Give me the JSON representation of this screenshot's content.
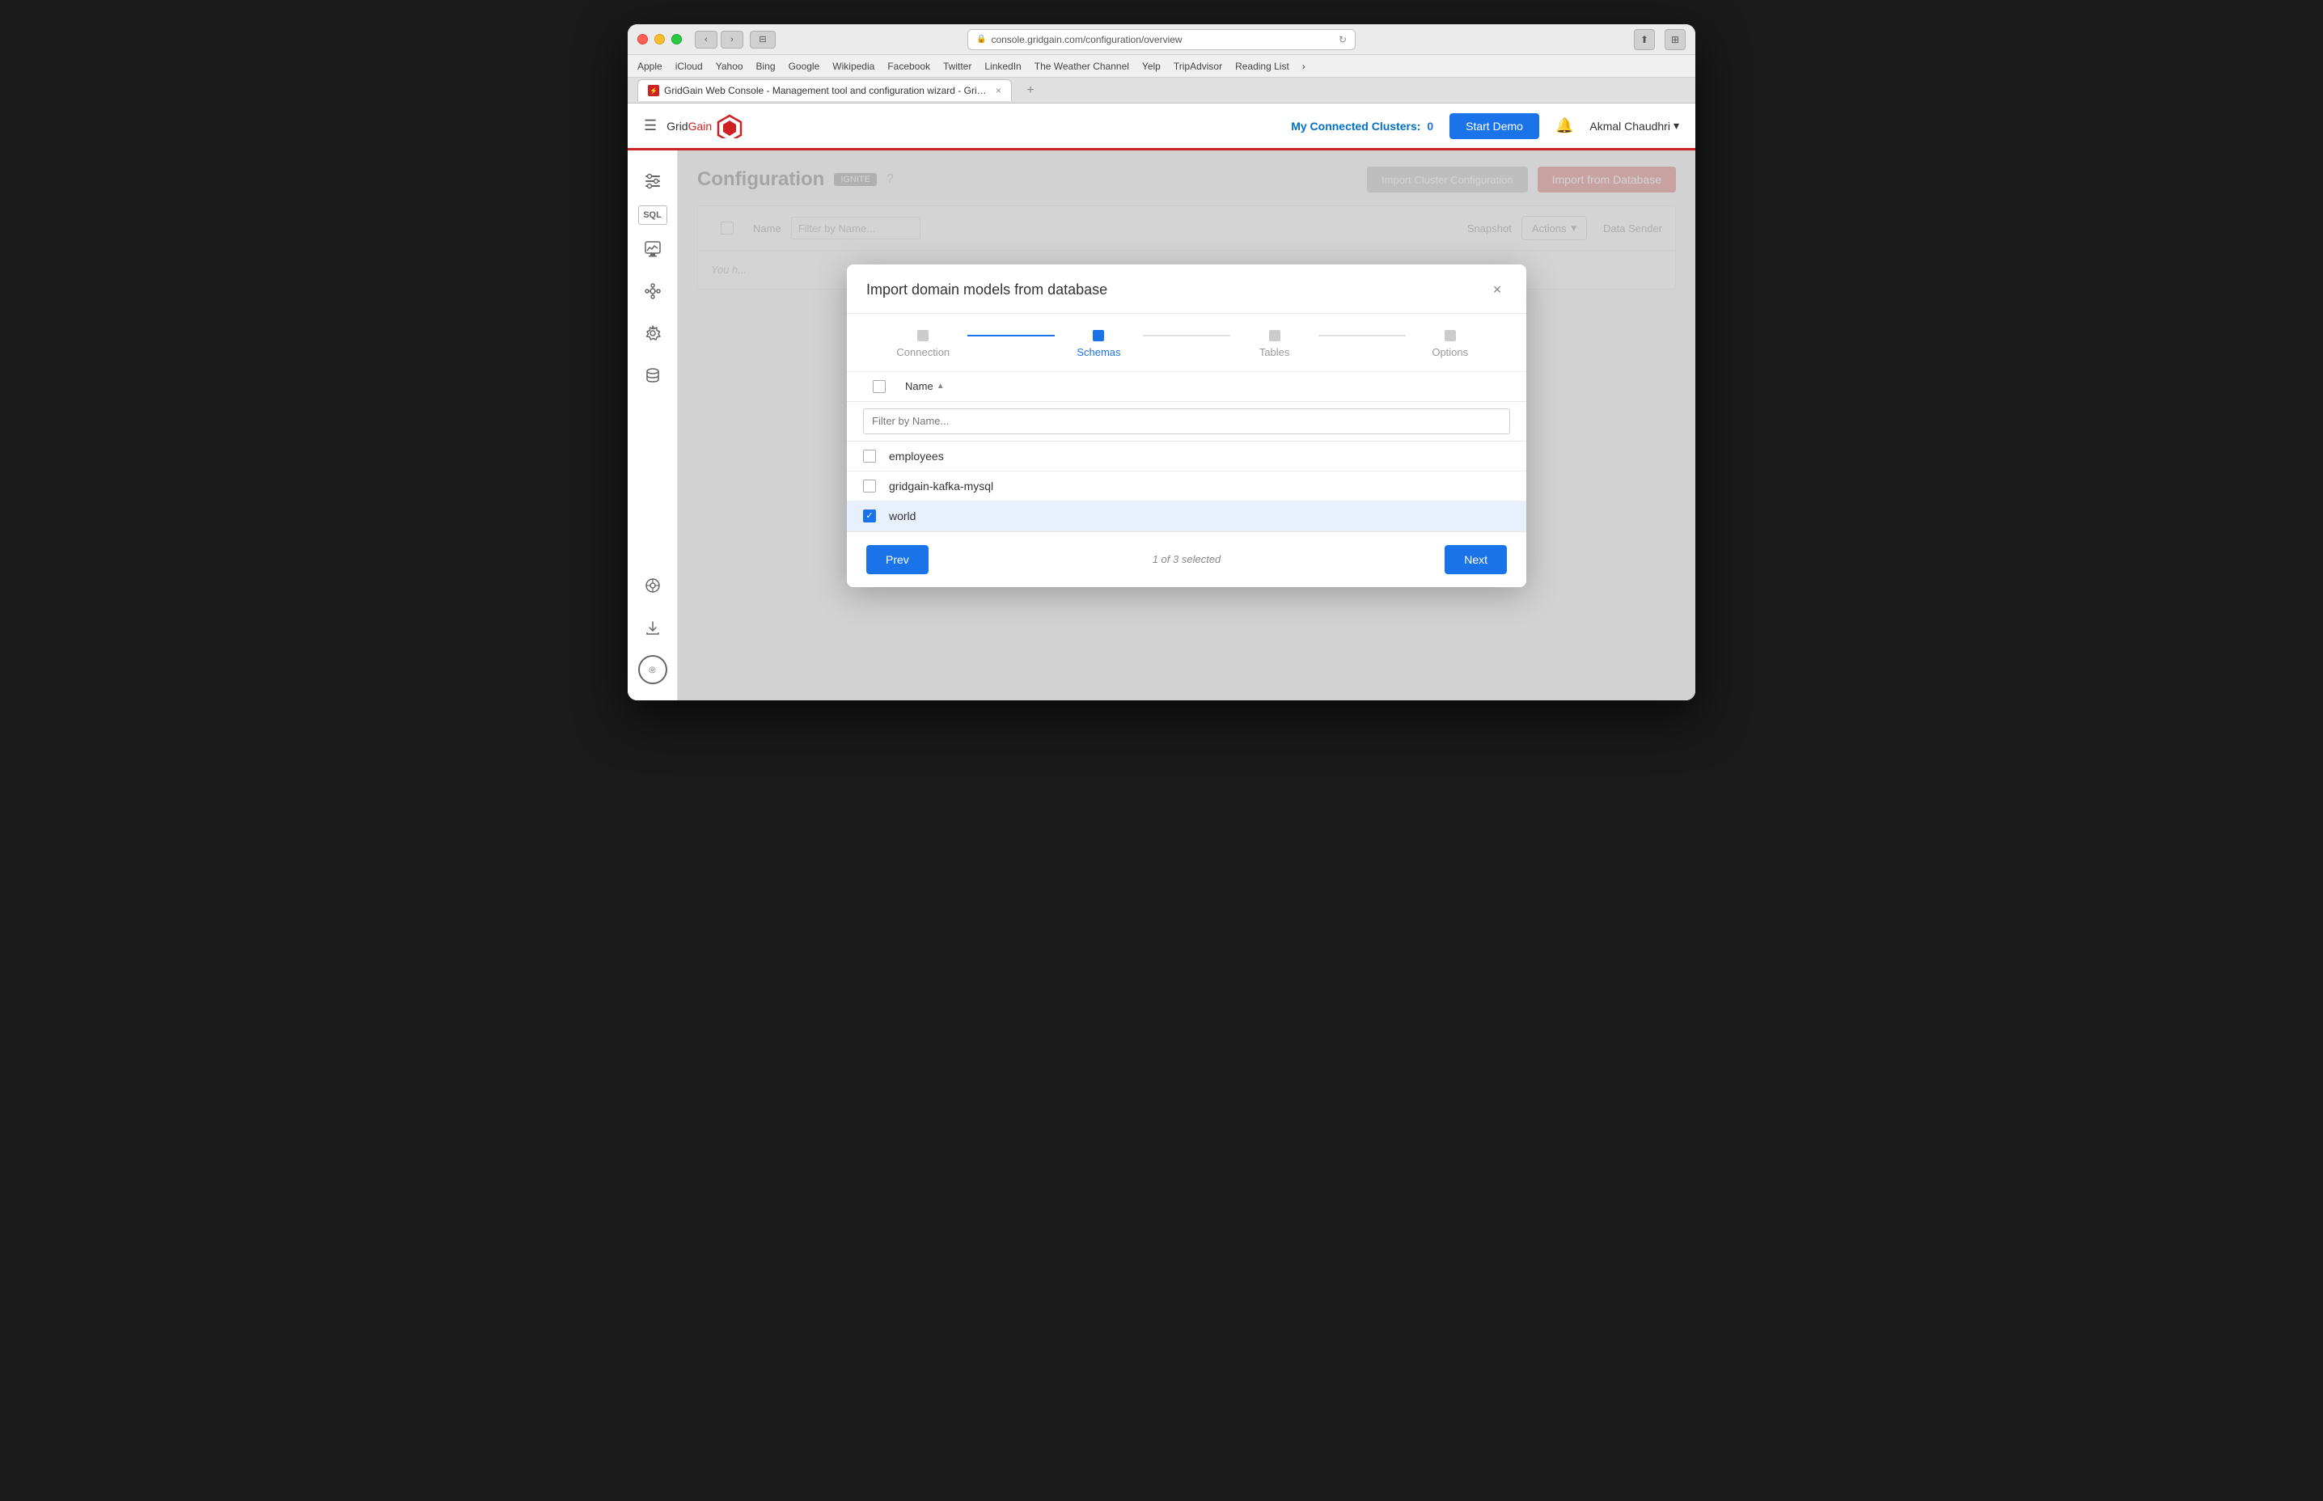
{
  "browser": {
    "url": "console.gridgain.com/configuration/overview",
    "tab_title": "GridGain Web Console - Management tool and configuration wizard - GridGain Web Console",
    "bookmarks": [
      "Apple",
      "iCloud",
      "Yahoo",
      "Bing",
      "Google",
      "Wikipedia",
      "Facebook",
      "Twitter",
      "LinkedIn",
      "The Weather Channel",
      "Yelp",
      "TripAdvisor",
      "Reading List"
    ]
  },
  "header": {
    "hamburger": "☰",
    "logo_grid": "Grid",
    "logo_gain": "Gain",
    "connected_clusters_label": "My Connected Clusters:",
    "connected_clusters_count": "0",
    "start_demo_label": "Start Demo",
    "user_name": "Akmal Chaudhri",
    "user_dropdown_arrow": "▾"
  },
  "sidebar": {
    "items": [
      {
        "name": "configuration-icon",
        "icon": "⚙",
        "label": "Configuration"
      },
      {
        "name": "sql-icon",
        "icon": "SQL",
        "label": "SQL"
      },
      {
        "name": "monitoring-icon",
        "icon": "📈",
        "label": "Monitoring"
      },
      {
        "name": "cluster-icon",
        "icon": "⬡",
        "label": "Cluster"
      },
      {
        "name": "settings-icon",
        "icon": "⚙",
        "label": "Settings"
      },
      {
        "name": "database-icon",
        "icon": "🗄",
        "label": "Database"
      },
      {
        "name": "support-icon",
        "icon": "☎",
        "label": "Support"
      },
      {
        "name": "download-icon",
        "icon": "⬇",
        "label": "Download"
      },
      {
        "name": "agent-icon",
        "icon": "◎",
        "label": "Agent"
      }
    ]
  },
  "page": {
    "title": "Configuration",
    "badge": "IGNITE",
    "import_from_db_label": "Import from Database",
    "cluster_config_label": "Import Cluster Configuration",
    "actions_label": "Actions",
    "actions_dropdown_arrow": "▾",
    "col_snapshot": "Snapshot",
    "col_datasender": "Data Sender",
    "col_name": "Name",
    "filter_placeholder": "Filter by Name...",
    "you_have_msg": "You h..."
  },
  "modal": {
    "title": "Import domain models from database",
    "close_icon": "×",
    "stepper": {
      "steps": [
        {
          "label": "Connection",
          "state": "done"
        },
        {
          "label": "Schemas",
          "state": "active"
        },
        {
          "label": "Tables",
          "state": "inactive"
        },
        {
          "label": "Options",
          "state": "inactive"
        }
      ]
    },
    "table": {
      "col_name_label": "Name",
      "sort_icon": "▲",
      "filter_placeholder": "Filter by Name...",
      "rows": [
        {
          "id": "employees",
          "name": "employees",
          "checked": false,
          "selected": false
        },
        {
          "id": "gridgain-kafka-mysql",
          "name": "gridgain-kafka-mysql",
          "checked": false,
          "selected": false
        },
        {
          "id": "world",
          "name": "world",
          "checked": true,
          "selected": true
        }
      ]
    },
    "footer": {
      "prev_label": "Prev",
      "selected_text": "1 of 3 selected",
      "next_label": "Next"
    }
  }
}
